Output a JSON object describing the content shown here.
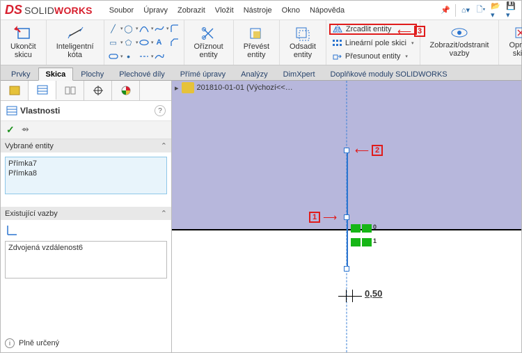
{
  "app": {
    "brand_prefix": "SOLID",
    "brand_suffix": "WORKS"
  },
  "menu": [
    "Soubor",
    "Úpravy",
    "Zobrazit",
    "Vložit",
    "Nástroje",
    "Okno",
    "Nápověda"
  ],
  "ribbon": {
    "exit_sketch": "Ukončit\nskicu",
    "smart_dim": "Inteligentní\nkóta",
    "trim": "Oříznout\nentity",
    "convert": "Převést\nentity",
    "offset": "Odsadit\nentity",
    "mirror": "Zrcadlit entity",
    "linear": "Lineární pole skici",
    "move": "Přesunout entity",
    "display": "Zobrazit/odstranit\nvazby",
    "repair": "Opravit\nskicu"
  },
  "tabs": [
    "Prvky",
    "Skica",
    "Plochy",
    "Plechové díly",
    "Přímé úpravy",
    "Analýzy",
    "DimXpert",
    "Doplňkové moduly SOLIDWORKS"
  ],
  "active_tab": "Skica",
  "breadcrumb": {
    "part": "201810-01-01",
    "config": "(Výchozí<<…"
  },
  "panel": {
    "title": "Vlastnosti",
    "section_selected": "Vybrané entity",
    "selected_items": [
      "Přímka7",
      "Přímka8"
    ],
    "section_relations": "Existující vazby",
    "relations": [
      "Zdvojená vzdálenost6"
    ],
    "status": "Plně určený"
  },
  "callouts": {
    "c1": "1",
    "c2": "2",
    "c3": "3"
  },
  "geometry": {
    "dim_value": "0,50",
    "marker0": "0",
    "marker1": "1"
  }
}
